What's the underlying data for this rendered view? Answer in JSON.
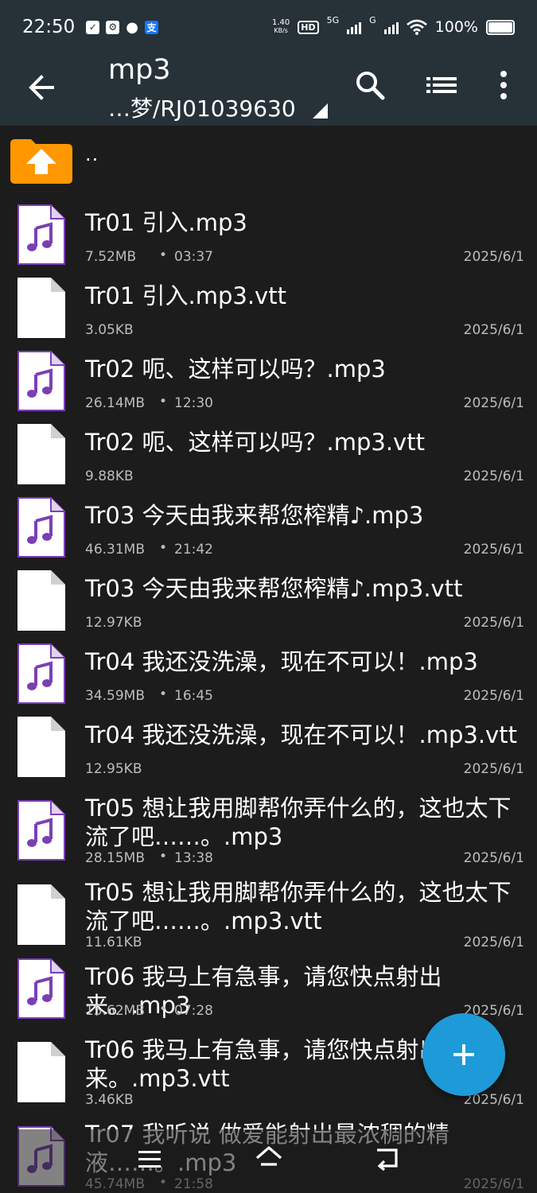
{
  "status_bar": {
    "time": "22:50",
    "speed_value": "1.40",
    "speed_unit": "KB/s",
    "hd": "HD",
    "network_1": "5G",
    "network_2": "G",
    "battery": "100%"
  },
  "app_bar": {
    "title": "mp3",
    "path": "…梦/RJ01039630",
    "icons": [
      "back-arrow-icon",
      "search-icon",
      "list-view-icon",
      "more-vert-icon"
    ]
  },
  "parent_dir": {
    "label": ".."
  },
  "files": [
    {
      "name": "Tr01 引入.mp3",
      "size": "7.52MB",
      "duration": "03:37",
      "date": "2025/6/1",
      "type": "audio"
    },
    {
      "name": "Tr01 引入.mp3.vtt",
      "size": "3.05KB",
      "duration": "",
      "date": "2025/6/1",
      "type": "text"
    },
    {
      "name": "Tr02 呃、这样可以吗？.mp3",
      "size": "26.14MB",
      "duration": "12:30",
      "date": "2025/6/1",
      "type": "audio"
    },
    {
      "name": "Tr02 呃、这样可以吗？.mp3.vtt",
      "size": "9.88KB",
      "duration": "",
      "date": "2025/6/1",
      "type": "text"
    },
    {
      "name": "Tr03 今天由我来帮您榨精♪.mp3",
      "size": "46.31MB",
      "duration": "21:42",
      "date": "2025/6/1",
      "type": "audio"
    },
    {
      "name": "Tr03 今天由我来帮您榨精♪.mp3.vtt",
      "size": "12.97KB",
      "duration": "",
      "date": "2025/6/1",
      "type": "text"
    },
    {
      "name": "Tr04 我还没洗澡，现在不可以！.mp3",
      "size": "34.59MB",
      "duration": "16:45",
      "date": "2025/6/1",
      "type": "audio"
    },
    {
      "name": "Tr04 我还没洗澡，现在不可以！.mp3.vtt",
      "size": "12.95KB",
      "duration": "",
      "date": "2025/6/1",
      "type": "text"
    },
    {
      "name": "Tr05 想让我用脚帮你弄什么的，这也太下流了吧……。.mp3",
      "size": "28.15MB",
      "duration": "13:38",
      "date": "2025/6/1",
      "type": "audio"
    },
    {
      "name": "Tr05 想让我用脚帮你弄什么的，这也太下流了吧……。.mp3.vtt",
      "size": "11.61KB",
      "duration": "",
      "date": "2025/6/1",
      "type": "text"
    },
    {
      "name": "Tr06 我马上有急事，请您快点射出来。.mp3",
      "size": "15.62MB",
      "duration": "07:28",
      "date": "2025/6/1",
      "type": "audio"
    },
    {
      "name": "Tr06 我马上有急事，请您快点射出来。.mp3.vtt",
      "size": "3.46KB",
      "duration": "",
      "date": "2025/6/1",
      "type": "text"
    },
    {
      "name": "Tr07 我听说 做爱能射出最浓稠的精液……。.mp3",
      "size": "45.74MB",
      "duration": "21:58",
      "date": "2025/6/1",
      "type": "audio"
    }
  ],
  "fab": {
    "icon": "plus-icon"
  },
  "nav_bar": {
    "icons": [
      "menu-icon",
      "home-icon",
      "back-icon"
    ]
  },
  "colors": {
    "bar": "#263238",
    "background": "#1c1c1c",
    "fab": "#1e9ad8",
    "folder": "#ff9800",
    "audio_note": "#7b3fb5"
  }
}
